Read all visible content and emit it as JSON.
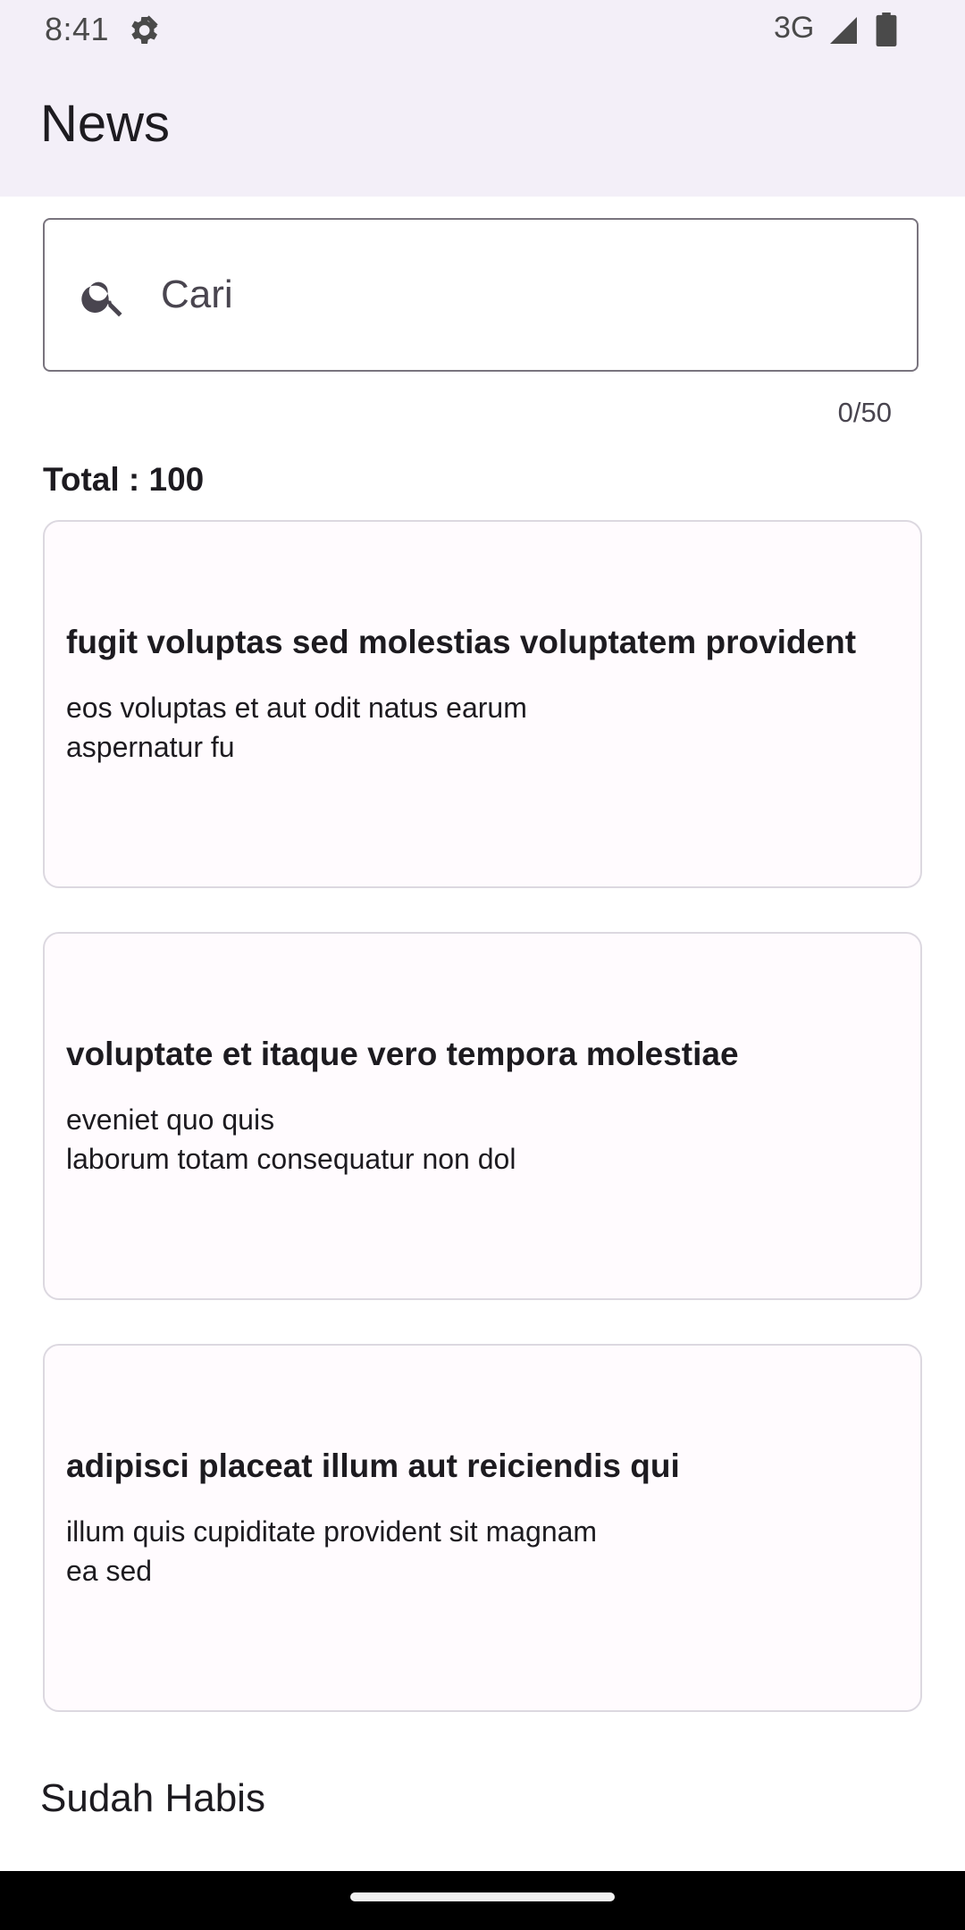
{
  "status_bar": {
    "time": "8:41",
    "network": "3G",
    "icons": [
      "settings-gear-icon",
      "signal-icon",
      "battery-icon"
    ]
  },
  "app_bar": {
    "title": "News"
  },
  "search": {
    "placeholder": "Cari",
    "value": "",
    "counter": "0/50",
    "icon": "search-icon"
  },
  "total": {
    "label": "Total : 100"
  },
  "articles": [
    {
      "title": "fugit voluptas sed molestias voluptatem provident",
      "body": "eos voluptas et aut odit natus earum\naspernatur fu"
    },
    {
      "title": "voluptate et itaque vero tempora molestiae",
      "body": "eveniet quo quis\nlaborum totam consequatur non dol"
    },
    {
      "title": "adipisci placeat illum aut reiciendis qui",
      "body": "illum quis cupiditate provident sit magnam\nea sed"
    }
  ],
  "footer": {
    "text": "Sudah Habis"
  },
  "colors": {
    "app_bar_background": "#f3eff8",
    "outline": "#79747e",
    "card_border": "#dcd8e0",
    "text_primary": "#1d1b20",
    "text_secondary": "#49454f",
    "nav_bar": "#000000"
  }
}
